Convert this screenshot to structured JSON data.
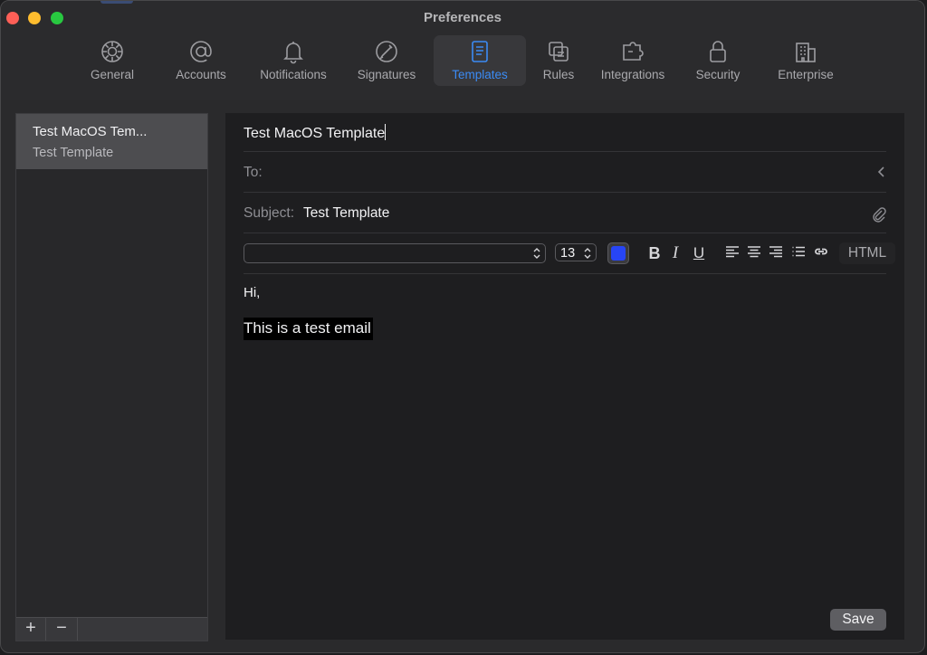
{
  "window": {
    "title": "Preferences"
  },
  "tabs": [
    {
      "label": "General",
      "icon": "gear-icon"
    },
    {
      "label": "Accounts",
      "icon": "at-icon"
    },
    {
      "label": "Notifications",
      "icon": "bell-icon"
    },
    {
      "label": "Signatures",
      "icon": "signature-icon"
    },
    {
      "label": "Templates",
      "icon": "document-icon",
      "active": true
    },
    {
      "label": "Rules",
      "icon": "rules-icon"
    },
    {
      "label": "Integrations",
      "icon": "puzzle-icon"
    },
    {
      "label": "Security",
      "icon": "lock-icon"
    },
    {
      "label": "Enterprise",
      "icon": "building-icon"
    }
  ],
  "template_list": {
    "items": [
      {
        "title": "Test MacOS Tem...",
        "subtitle": "Test Template"
      }
    ],
    "add_label": "+",
    "remove_label": "−"
  },
  "editor": {
    "template_name": "Test MacOS Template",
    "to_label": "To:",
    "to_value": "",
    "subject_label": "Subject:",
    "subject_value": "Test Template",
    "font_family_value": "",
    "font_size_value": "13",
    "text_color": "#2745f5",
    "bold_label": "B",
    "italic_label": "I",
    "underline_label": "U",
    "html_label": "HTML",
    "body_line1": "Hi,",
    "body_line2": "This is a test email",
    "save_label": "Save"
  },
  "colors": {
    "accent": "#3b8bf5",
    "background": "#2a2a2c"
  }
}
